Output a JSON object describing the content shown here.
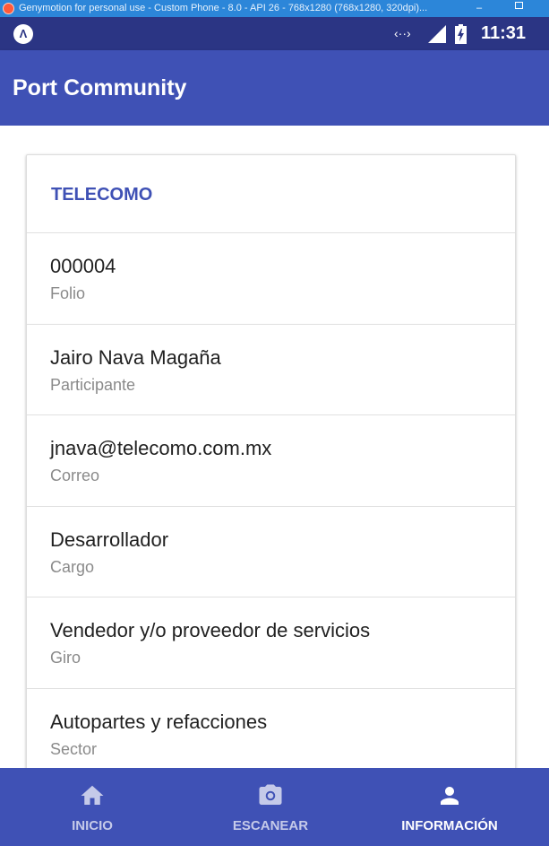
{
  "window": {
    "title": "Genymotion for personal use - Custom Phone - 8.0 - API 26 - 768x1280 (768x1280, 320dpi)...",
    "minimize_glyph": "–"
  },
  "status_bar": {
    "app_badge": "Λ",
    "data_glyph": "‹··›",
    "time": "11:31"
  },
  "app_bar": {
    "title": "Port Community"
  },
  "card": {
    "company": "TELECOMO",
    "rows": [
      {
        "value": "000004",
        "label": "Folio"
      },
      {
        "value": "Jairo Nava Magaña",
        "label": "Participante"
      },
      {
        "value": "jnava@telecomo.com.mx",
        "label": "Correo"
      },
      {
        "value": "Desarrollador",
        "label": "Cargo"
      },
      {
        "value": "Vendedor y/o proveedor de servicios",
        "label": "Giro"
      },
      {
        "value": "Autopartes y refacciones",
        "label": "Sector"
      }
    ]
  },
  "bottom_nav": {
    "items": [
      {
        "label": "INICIO",
        "icon": "home-icon",
        "active": false
      },
      {
        "label": "ESCANEAR",
        "icon": "camera-icon",
        "active": false
      },
      {
        "label": "INFORMACIÓN",
        "icon": "person-icon",
        "active": true
      }
    ]
  },
  "colors": {
    "primary": "#3f51b5",
    "primary_dark": "#2b3584",
    "inactive_nav_label": "#c5cae9"
  }
}
